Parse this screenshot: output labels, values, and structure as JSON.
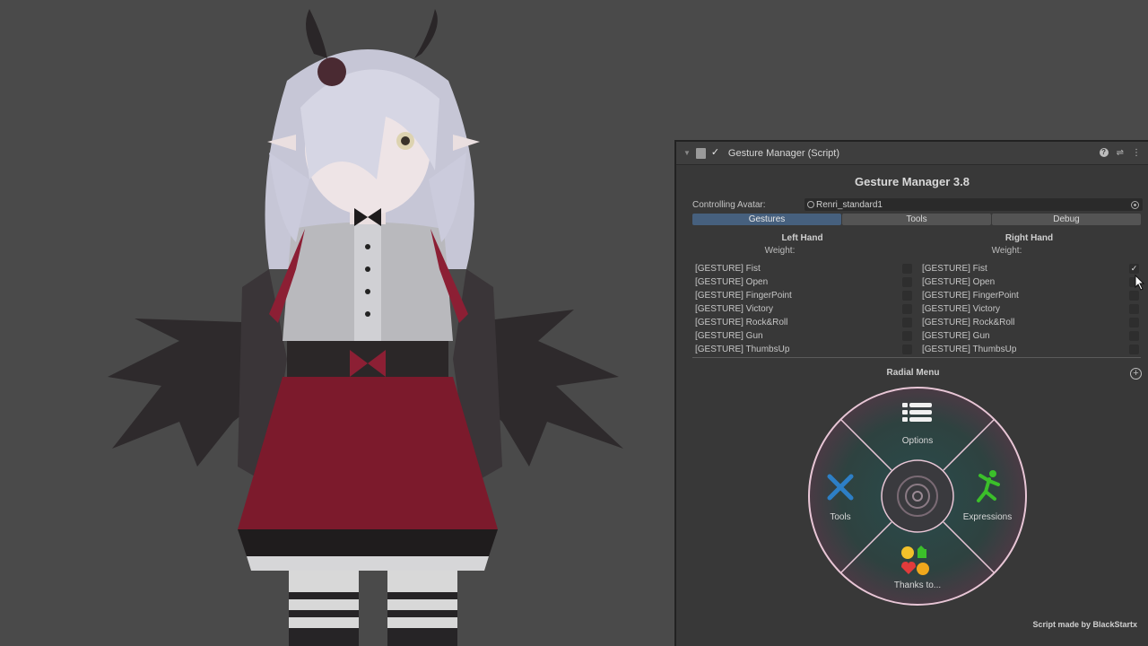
{
  "inspector": {
    "component_title": "Gesture Manager (Script)",
    "heading": "Gesture Manager 3.8",
    "controlling_avatar_label": "Controlling Avatar:",
    "controlling_avatar_value": "Renri_standard1",
    "tabs": [
      {
        "label": "Gestures",
        "active": true
      },
      {
        "label": "Tools",
        "active": false
      },
      {
        "label": "Debug",
        "active": false
      }
    ],
    "left_hand": {
      "title": "Left Hand",
      "weight_label": "Weight:",
      "gestures": [
        {
          "name": "[GESTURE] Fist",
          "checked": false
        },
        {
          "name": "[GESTURE] Open",
          "checked": false
        },
        {
          "name": "[GESTURE] FingerPoint",
          "checked": false
        },
        {
          "name": "[GESTURE] Victory",
          "checked": false
        },
        {
          "name": "[GESTURE] Rock&Roll",
          "checked": false
        },
        {
          "name": "[GESTURE] Gun",
          "checked": false
        },
        {
          "name": "[GESTURE] ThumbsUp",
          "checked": false
        }
      ]
    },
    "right_hand": {
      "title": "Right Hand",
      "weight_label": "Weight:",
      "gestures": [
        {
          "name": "[GESTURE] Fist",
          "checked": true
        },
        {
          "name": "[GESTURE] Open",
          "checked": false
        },
        {
          "name": "[GESTURE] FingerPoint",
          "checked": false
        },
        {
          "name": "[GESTURE] Victory",
          "checked": false
        },
        {
          "name": "[GESTURE] Rock&Roll",
          "checked": false
        },
        {
          "name": "[GESTURE] Gun",
          "checked": false
        },
        {
          "name": "[GESTURE] ThumbsUp",
          "checked": false
        }
      ]
    },
    "radial_menu": {
      "title": "Radial Menu",
      "items": {
        "top": {
          "label": "Options",
          "icon": "list-icon"
        },
        "left": {
          "label": "Tools",
          "icon": "tools-icon"
        },
        "right": {
          "label": "Expressions",
          "icon": "dancing-figure-icon"
        },
        "bottom": {
          "label": "Thanks to...",
          "icon": "emoji-cluster-icon"
        }
      },
      "center_icon": "target-icon"
    },
    "credit": "Script made by BlackStartx"
  },
  "colors": {
    "viewport_bg": "#4a4a4a",
    "panel_bg": "#383838",
    "tab_active": "#46607e",
    "radial_ring": "#e8c6d6",
    "radial_fill": "#2f4a4a"
  }
}
